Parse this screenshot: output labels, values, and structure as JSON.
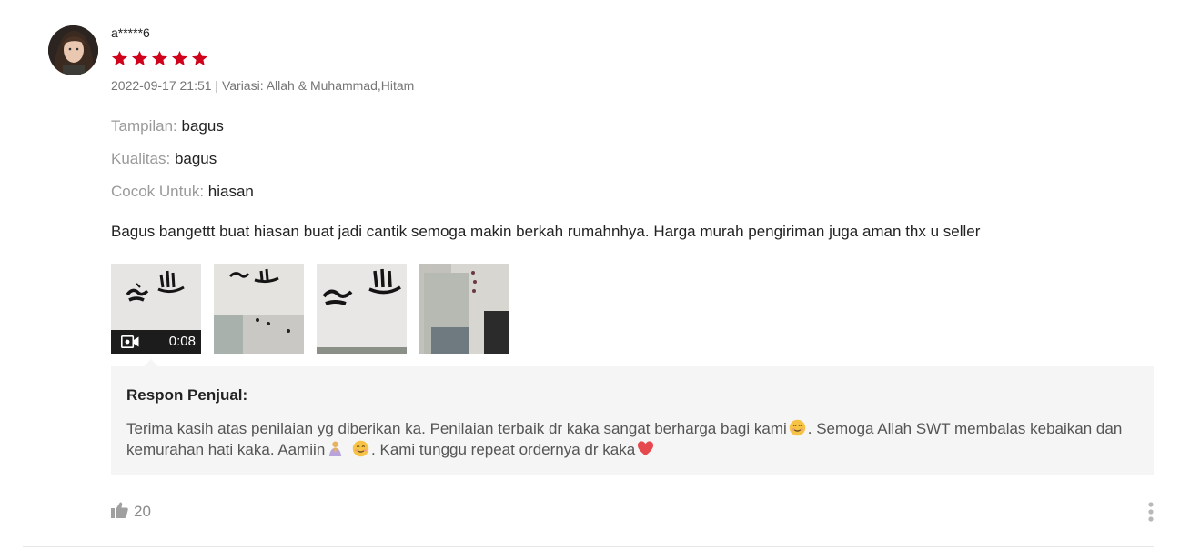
{
  "review": {
    "username": "a*****6",
    "rating": 5,
    "star_color": "#d0011b",
    "meta": "2022-09-17 21:51 | Variasi: Allah & Muhammad,Hitam",
    "attributes": [
      {
        "label": "Tampilan:",
        "value": "bagus"
      },
      {
        "label": "Kualitas:",
        "value": "bagus"
      },
      {
        "label": "Cocok Untuk:",
        "value": "hiasan"
      }
    ],
    "comment": "Bagus bangettt buat hiasan buat jadi cantik semoga makin berkah rumahnhya. Harga murah pengiriman juga aman thx u seller",
    "media": {
      "video_duration": "0:08",
      "video_icon": "video-camera-icon"
    },
    "seller_response": {
      "title": "Respon Penjual:",
      "part1": "Terima kasih atas penilaian yg diberikan ka. Penilaian terbaik dr kaka sangat berharga bagi kami",
      "part2": ". Semoga Allah SWT membalas kebaikan dan kemurahan hati kaka. Aamiin",
      "part3": ". Kami tunggu repeat ordernya dr kaka"
    },
    "likes": "20",
    "like_icon": "thumbs-up-icon",
    "more_icon": "more-vertical-icon"
  }
}
